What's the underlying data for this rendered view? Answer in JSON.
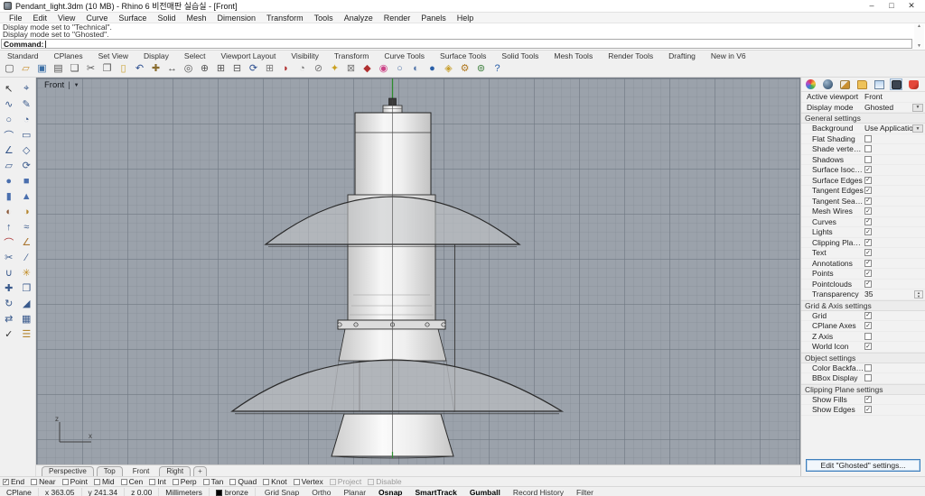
{
  "window": {
    "title": "Pendant_light.3dm (10 MB) - Rhino 6 비전매판 실습실 - [Front]",
    "controls": [
      {
        "name": "minimize",
        "glyph": "–"
      },
      {
        "name": "maximize",
        "glyph": "□"
      },
      {
        "name": "close",
        "glyph": "✕"
      }
    ]
  },
  "menu": {
    "items": [
      "File",
      "Edit",
      "View",
      "Curve",
      "Surface",
      "Solid",
      "Mesh",
      "Dimension",
      "Transform",
      "Tools",
      "Analyze",
      "Render",
      "Panels",
      "Help"
    ]
  },
  "command": {
    "history": [
      "Display mode set to \"Technical\".",
      "Display mode set to \"Ghosted\"."
    ],
    "prompt": "Command:"
  },
  "toolbar": {
    "tabs": [
      "Standard",
      "CPlanes",
      "Set View",
      "Display",
      "Select",
      "Viewport Layout",
      "Visibility",
      "Transform",
      "Curve Tools",
      "Surface Tools",
      "Solid Tools",
      "Mesh Tools",
      "Render Tools",
      "Drafting",
      "New in V6"
    ],
    "icons": [
      {
        "name": "new-file",
        "glyph": "▢",
        "color": "#555555"
      },
      {
        "name": "open-file",
        "glyph": "▱",
        "color": "#c89030"
      },
      {
        "name": "save",
        "glyph": "▣",
        "color": "#3b6ea5"
      },
      {
        "name": "print",
        "glyph": "▤",
        "color": "#555555"
      },
      {
        "name": "export",
        "glyph": "❏",
        "color": "#555555"
      },
      {
        "name": "cut",
        "glyph": "✂",
        "color": "#555555"
      },
      {
        "name": "copy",
        "glyph": "❐",
        "color": "#555555"
      },
      {
        "name": "paste",
        "glyph": "▯",
        "color": "#c8a030"
      },
      {
        "name": "undo",
        "glyph": "↶",
        "color": "#2a4d8f"
      },
      {
        "name": "pan-view",
        "glyph": "✚",
        "color": "#8a6d2f"
      },
      {
        "name": "move",
        "glyph": "↔",
        "color": "#555555"
      },
      {
        "name": "zoom",
        "glyph": "◎",
        "color": "#555555"
      },
      {
        "name": "zoom-dynamic",
        "glyph": "⊕",
        "color": "#555555"
      },
      {
        "name": "zoom-window",
        "glyph": "⊞",
        "color": "#555555"
      },
      {
        "name": "zoom-extents",
        "glyph": "⊟",
        "color": "#555555"
      },
      {
        "name": "rotate-view",
        "glyph": "⟳",
        "color": "#2a4d8f"
      },
      {
        "name": "viewport-layout",
        "glyph": "⊞",
        "color": "#777777"
      },
      {
        "name": "shade",
        "glyph": "◗",
        "color": "#b03030"
      },
      {
        "name": "wireframe",
        "glyph": "◔",
        "color": "#777777"
      },
      {
        "name": "hide-object",
        "glyph": "⊘",
        "color": "#777777"
      },
      {
        "name": "light",
        "glyph": "✦",
        "color": "#caa020"
      },
      {
        "name": "lock",
        "glyph": "⊠",
        "color": "#777777"
      },
      {
        "name": "layer-state",
        "glyph": "◆",
        "color": "#b03030"
      },
      {
        "name": "color-wheel",
        "glyph": "◉",
        "color": "#cc4488"
      },
      {
        "name": "ghosted-view",
        "glyph": "○",
        "color": "#5577aa"
      },
      {
        "name": "shaded-view",
        "glyph": "◐",
        "color": "#5577aa"
      },
      {
        "name": "rendered-view",
        "glyph": "●",
        "color": "#2a5fa8"
      },
      {
        "name": "material",
        "glyph": "◈",
        "color": "#c8a030"
      },
      {
        "name": "options-gears",
        "glyph": "⚙",
        "color": "#b07820"
      },
      {
        "name": "web-globe",
        "glyph": "⊚",
        "color": "#3a7d3a"
      },
      {
        "name": "help",
        "glyph": "?",
        "color": "#2a5fa8"
      }
    ]
  },
  "side_tools": [
    {
      "name": "select",
      "glyph": "↖",
      "color": "#333333"
    },
    {
      "name": "control-points",
      "glyph": "⌖",
      "color": "#3a5a8c"
    },
    {
      "name": "curve",
      "glyph": "∿",
      "color": "#3a5a8c"
    },
    {
      "name": "curve-interpolate",
      "glyph": "✎",
      "color": "#3a5a8c"
    },
    {
      "name": "circle",
      "glyph": "○",
      "color": "#3a5a8c"
    },
    {
      "name": "ellipse",
      "glyph": "◔",
      "color": "#3a5a8c"
    },
    {
      "name": "arc",
      "glyph": "⌒",
      "color": "#3a5a8c"
    },
    {
      "name": "rectangle",
      "glyph": "▭",
      "color": "#3a5a8c"
    },
    {
      "name": "polyline",
      "glyph": "∠",
      "color": "#3a5a8c"
    },
    {
      "name": "polygon",
      "glyph": "◇",
      "color": "#3a5a8c"
    },
    {
      "name": "surface",
      "glyph": "▱",
      "color": "#3a5a8c"
    },
    {
      "name": "revolve",
      "glyph": "⟳",
      "color": "#3a5a8c"
    },
    {
      "name": "sphere",
      "glyph": "●",
      "color": "#4a6fae"
    },
    {
      "name": "box",
      "glyph": "■",
      "color": "#4a6fae"
    },
    {
      "name": "cylinder",
      "glyph": "▮",
      "color": "#4a6fae"
    },
    {
      "name": "cone",
      "glyph": "▲",
      "color": "#4a6fae"
    },
    {
      "name": "boolean-union",
      "glyph": "◐",
      "color": "#8c5a3a"
    },
    {
      "name": "boolean-difference",
      "glyph": "◑",
      "color": "#b5862f"
    },
    {
      "name": "extrude",
      "glyph": "↑",
      "color": "#3a5a8c"
    },
    {
      "name": "loft",
      "glyph": "≈",
      "color": "#3a5a8c"
    },
    {
      "name": "fillet",
      "glyph": "⌒",
      "color": "#aa3333"
    },
    {
      "name": "chamfer",
      "glyph": "∠",
      "color": "#aa7733"
    },
    {
      "name": "trim",
      "glyph": "✂",
      "color": "#3a5a8c"
    },
    {
      "name": "split",
      "glyph": "∕",
      "color": "#3a5a8c"
    },
    {
      "name": "join",
      "glyph": "∪",
      "color": "#3a5a8c"
    },
    {
      "name": "explode",
      "glyph": "✳",
      "color": "#c08a20"
    },
    {
      "name": "move",
      "glyph": "✚",
      "color": "#3a5a8c"
    },
    {
      "name": "copy",
      "glyph": "❐",
      "color": "#3a5a8c"
    },
    {
      "name": "rotate",
      "glyph": "↻",
      "color": "#3a5a8c"
    },
    {
      "name": "scale",
      "glyph": "◢",
      "color": "#3a5a8c"
    },
    {
      "name": "mirror",
      "glyph": "⇄",
      "color": "#3a5a8c"
    },
    {
      "name": "array",
      "glyph": "▦",
      "color": "#3a5a8c"
    },
    {
      "name": "check",
      "glyph": "✓",
      "color": "#333333"
    },
    {
      "name": "layers",
      "glyph": "☰",
      "color": "#b5862f"
    }
  ],
  "viewport": {
    "label": "Front",
    "axis_labels": {
      "vertical": "z",
      "horizontal": "x"
    }
  },
  "viewport_tabs": {
    "items": [
      "Perspective",
      "Top",
      "Front",
      "Right",
      "+"
    ],
    "active": "Front"
  },
  "panel": {
    "tabs": [
      {
        "name": "properties-tab",
        "kind": "wheel",
        "active": false
      },
      {
        "name": "render-tab",
        "kind": "sphere",
        "active": false
      },
      {
        "name": "material-tab",
        "kind": "brush",
        "active": false
      },
      {
        "name": "layers-tab",
        "kind": "folder",
        "active": false
      },
      {
        "name": "named-views-tab",
        "kind": "image",
        "active": false
      },
      {
        "name": "display-tab",
        "kind": "monitor",
        "active": true
      },
      {
        "name": "libraries-tab",
        "kind": "shield",
        "active": false
      }
    ],
    "rows": [
      {
        "t": "row",
        "label": "Active viewport",
        "value": "Front",
        "top": true
      },
      {
        "t": "row",
        "label": "Display mode",
        "value": "Ghosted",
        "combo": true,
        "top": true
      },
      {
        "t": "head",
        "label": "General settings"
      },
      {
        "t": "row",
        "label": "Background",
        "value": "Use Application ...",
        "combo": true
      },
      {
        "t": "check",
        "label": "Flat Shading",
        "v": false
      },
      {
        "t": "check",
        "label": "Shade vertex col...",
        "v": false
      },
      {
        "t": "check",
        "label": "Shadows",
        "v": false
      },
      {
        "t": "check",
        "label": "Surface Isocurves",
        "v": true
      },
      {
        "t": "check",
        "label": "Surface Edges",
        "v": true
      },
      {
        "t": "check",
        "label": "Tangent Edges",
        "v": true
      },
      {
        "t": "check",
        "label": "Tangent Seams",
        "v": true
      },
      {
        "t": "check",
        "label": "Mesh Wires",
        "v": true
      },
      {
        "t": "check",
        "label": "Curves",
        "v": true
      },
      {
        "t": "check",
        "label": "Lights",
        "v": true
      },
      {
        "t": "check",
        "label": "Clipping Planes",
        "v": true
      },
      {
        "t": "check",
        "label": "Text",
        "v": true
      },
      {
        "t": "check",
        "label": "Annotations",
        "v": true
      },
      {
        "t": "check",
        "label": "Points",
        "v": true
      },
      {
        "t": "check",
        "label": "Pointclouds",
        "v": true
      },
      {
        "t": "spin",
        "label": "Transparency",
        "value": "35"
      },
      {
        "t": "head",
        "label": "Grid & Axis settings"
      },
      {
        "t": "check",
        "label": "Grid",
        "v": true
      },
      {
        "t": "check",
        "label": "CPlane Axes",
        "v": true
      },
      {
        "t": "check",
        "label": "Z Axis",
        "v": false
      },
      {
        "t": "check",
        "label": "World Icon",
        "v": true
      },
      {
        "t": "head",
        "label": "Object settings"
      },
      {
        "t": "check",
        "label": "Color Backfaces",
        "v": false
      },
      {
        "t": "check",
        "label": "BBox Display",
        "v": false
      },
      {
        "t": "head",
        "label": "Clipping Plane settings"
      },
      {
        "t": "check",
        "label": "Show Fills",
        "v": true
      },
      {
        "t": "check",
        "label": "Show Edges",
        "v": true
      }
    ],
    "edit_button": "Edit \"Ghosted\" settings..."
  },
  "osnap": {
    "items": [
      {
        "label": "End",
        "checked": true,
        "disabled": false
      },
      {
        "label": "Near",
        "checked": false,
        "disabled": false
      },
      {
        "label": "Point",
        "checked": false,
        "disabled": false
      },
      {
        "label": "Mid",
        "checked": false,
        "disabled": false
      },
      {
        "label": "Cen",
        "checked": false,
        "disabled": false
      },
      {
        "label": "Int",
        "checked": false,
        "disabled": false
      },
      {
        "label": "Perp",
        "checked": false,
        "disabled": false
      },
      {
        "label": "Tan",
        "checked": false,
        "disabled": false
      },
      {
        "label": "Quad",
        "checked": false,
        "disabled": false
      },
      {
        "label": "Knot",
        "checked": false,
        "disabled": false
      },
      {
        "label": "Vertex",
        "checked": false,
        "disabled": false
      },
      {
        "label": "Project",
        "checked": false,
        "disabled": true
      },
      {
        "label": "Disable",
        "checked": false,
        "disabled": true
      }
    ]
  },
  "status": {
    "segments": [
      "CPlane",
      "x 363.05",
      "y 241.34",
      "z 0.00",
      "Millimeters"
    ],
    "material": "bronze",
    "material_swatch_color": "#000000",
    "toggles": [
      {
        "label": "Grid Snap",
        "bold": false
      },
      {
        "label": "Ortho",
        "bold": false
      },
      {
        "label": "Planar",
        "bold": false
      },
      {
        "label": "Osnap",
        "bold": true
      },
      {
        "label": "SmartTrack",
        "bold": true
      },
      {
        "label": "Gumball",
        "bold": true
      },
      {
        "label": "Record History",
        "bold": false
      },
      {
        "label": "Filter",
        "bold": false
      }
    ]
  }
}
